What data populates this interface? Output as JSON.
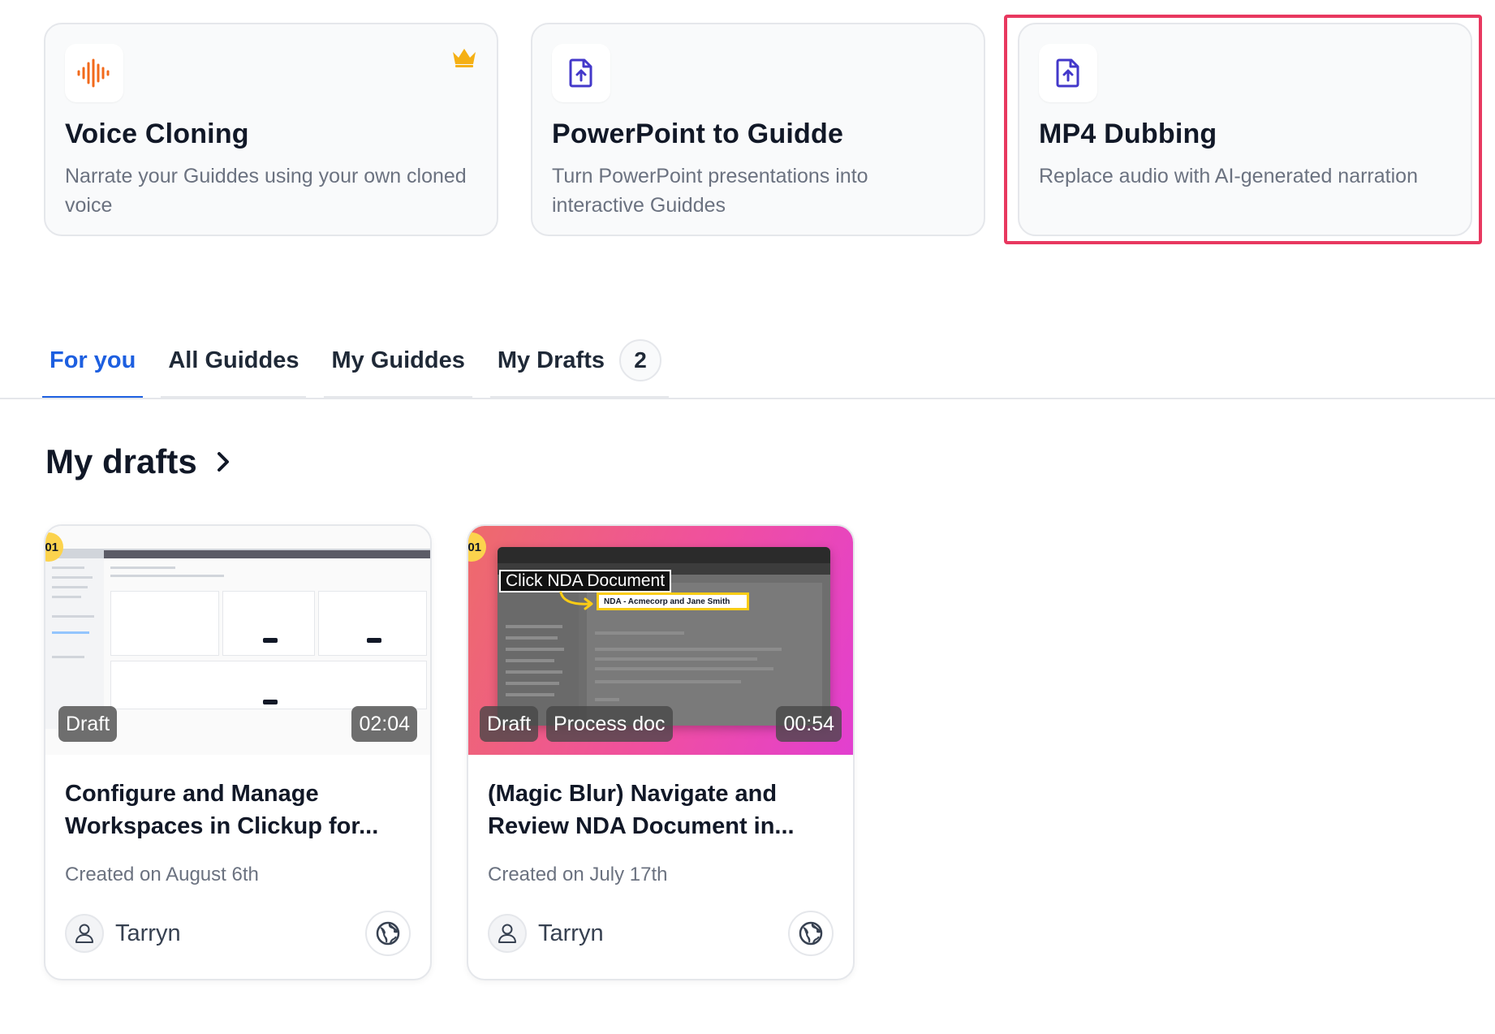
{
  "features": [
    {
      "title": "Voice Cloning",
      "description": "Narrate your Guiddes using your own cloned voice",
      "icon": "sound-wave-icon",
      "premium_icon": "crown-icon"
    },
    {
      "title": "PowerPoint to Guidde",
      "description": "Turn PowerPoint presentations into interactive Guiddes",
      "icon": "file-upload-icon"
    },
    {
      "title": "MP4 Dubbing",
      "description": "Replace audio with AI-generated narration",
      "icon": "file-upload-icon",
      "highlighted": true
    }
  ],
  "tabs": [
    {
      "label": "For you",
      "active": true
    },
    {
      "label": "All Guiddes"
    },
    {
      "label": "My Guiddes"
    },
    {
      "label": "My Drafts",
      "count": "2"
    }
  ],
  "section": {
    "title": "My drafts"
  },
  "drafts": [
    {
      "status": "Draft",
      "duration": "02:04",
      "title": "Configure and Manage Workspaces in Clickup for...",
      "created": "Created on August 6th",
      "author": "Tarryn",
      "step": "01"
    },
    {
      "status": "Draft",
      "tag": "Process doc",
      "duration": "00:54",
      "title": "(Magic Blur) Navigate and Review NDA Document in...",
      "created": "Created on July 17th",
      "author": "Tarryn",
      "step": "01",
      "overlay_label": "Click NDA Document",
      "overlay_box": "NDA - Acmecorp and Jane Smith"
    }
  ],
  "colors": {
    "accent": "#1d5fe0",
    "highlight": "#e8385f",
    "voice_icon": "#f26a1b",
    "file_icon": "#4338ca",
    "crown": "#f5b014"
  }
}
